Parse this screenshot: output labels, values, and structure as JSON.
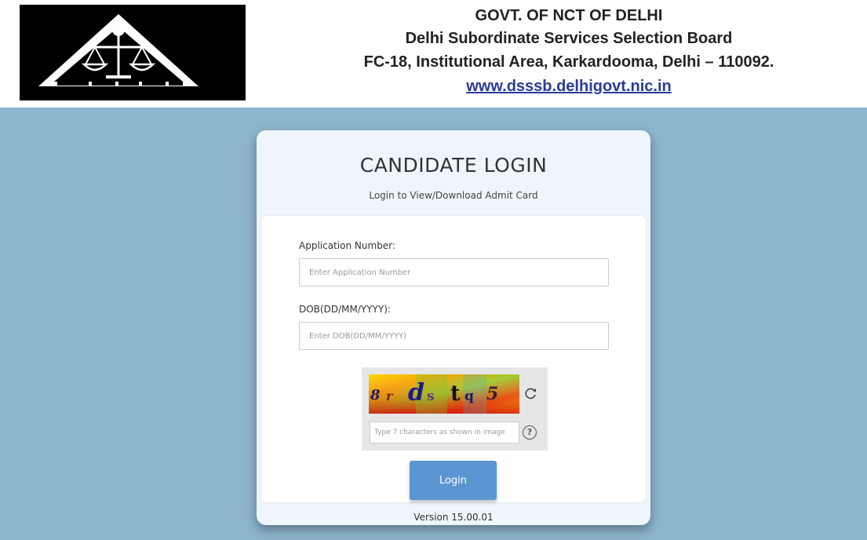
{
  "header": {
    "line1": "GOVT. OF NCT OF DELHI",
    "line2": "Delhi Subordinate Services Selection Board",
    "line3": "FC-18, Institutional Area, Karkardooma, Delhi – 110092.",
    "website": "www.dsssb.delhigovt.nic.in",
    "logo_icon": "dsssb-emblem-icon"
  },
  "card": {
    "title": "CANDIDATE LOGIN",
    "subtitle": "Login to View/Download Admit Card",
    "application_number": {
      "label": "Application Number:",
      "placeholder": "Enter Application Number",
      "value": ""
    },
    "dob": {
      "label": "DOB(DD/MM/YYYY):",
      "placeholder": "Enter DOB(DD/MM/YYYY)",
      "value": ""
    },
    "captcha": {
      "text": "8 r d s t q 5",
      "placeholder": "Type 7 characters as shown in image",
      "value": "",
      "refresh_icon": "refresh-icon",
      "help_icon": "help-icon",
      "help_glyph": "?"
    },
    "login_label": "Login",
    "version": "Version 15.00.01"
  },
  "colors": {
    "page_bg": "#8db5cd",
    "card_bg": "#eef5fb",
    "button_bg": "#5b96d3",
    "link": "#2a3a9a"
  }
}
